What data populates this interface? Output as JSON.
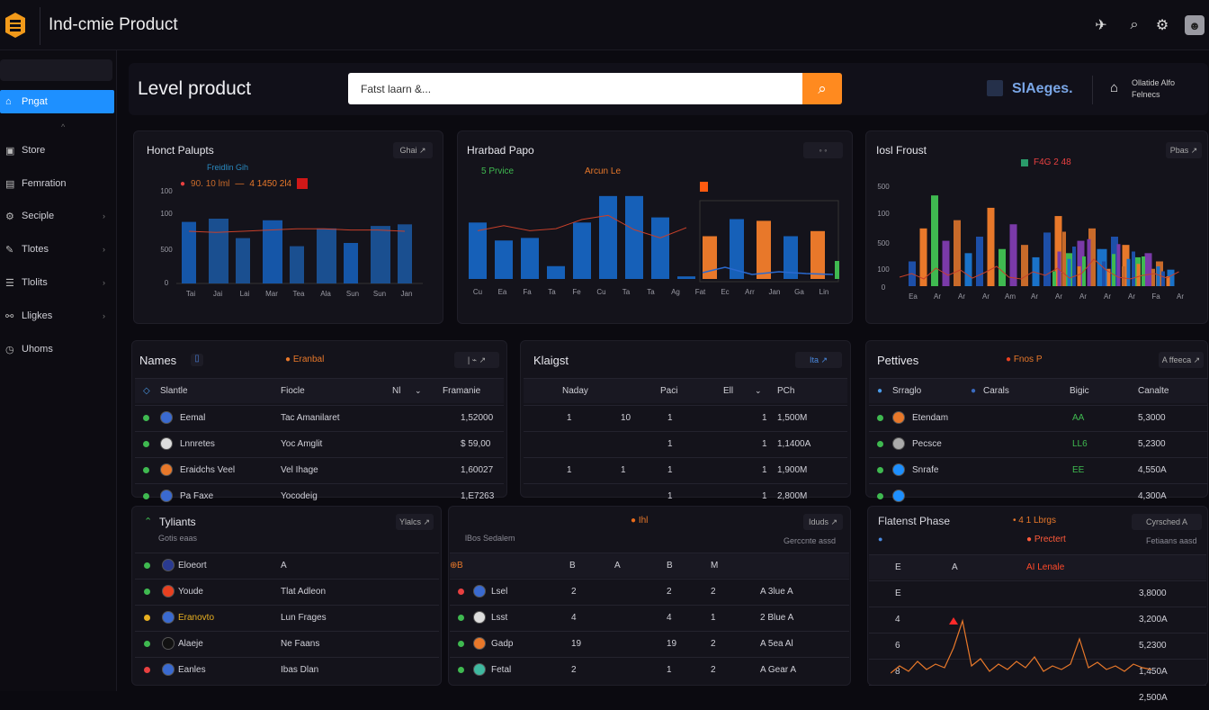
{
  "app": {
    "title": "Ind-cmie Product"
  },
  "header": {
    "page_title": "Level product",
    "search_value": "Fatst laarn &...",
    "brand": "SlAeges.",
    "user_line1": "Ollatide Alfo",
    "user_line2": "Felnecs"
  },
  "sidebar": {
    "items": [
      {
        "label": "Pngat",
        "icon": "home-icon",
        "active": true
      },
      {
        "label": "Store",
        "icon": "store-icon"
      },
      {
        "label": "Femration",
        "icon": "document-icon"
      },
      {
        "label": "Seciple",
        "icon": "gear-icon",
        "chevron": true
      },
      {
        "label": "Tlotes",
        "icon": "pencil-icon",
        "chevron": true
      },
      {
        "label": "Tlolits",
        "icon": "list-icon",
        "chevron": true
      },
      {
        "label": "Lligkes",
        "icon": "link-icon",
        "chevron": true
      },
      {
        "label": "Uhoms",
        "icon": "clock-icon"
      }
    ]
  },
  "charts": {
    "left": {
      "title": "Honct Palupts",
      "btn": "Ghai ↗",
      "legend1": "Freidlin Gih",
      "legend2": "90. 10 lml",
      "legend3": "4 1450 2l4",
      "yticks": [
        "100",
        "100",
        "500",
        "0"
      ],
      "xticks": [
        "Tai",
        "Jai",
        "Lai",
        "Mar",
        "Tea",
        "Ala",
        "Sun",
        "Sun",
        "Jan"
      ]
    },
    "mid": {
      "title": "Hrarbad Papo",
      "btn": "◦ ◦",
      "legend1": "5  Prvice",
      "legend2": "Arcun  Le",
      "xticks": [
        "Cu",
        "Ea",
        "Fa",
        "Ta",
        "Fe",
        "Cu",
        "Ta",
        "Ta",
        "Ag",
        "Fat",
        "Ec",
        "Arr",
        "Jan",
        "Ga",
        "Lin"
      ]
    },
    "right": {
      "title": "Iosl Froust",
      "btn": "Pbas ↗",
      "legend": "F4G 2 48",
      "yticks": [
        "500",
        "100",
        "500",
        "100",
        "0"
      ],
      "xticks": [
        "Ea",
        "Ar",
        "Ar",
        "Ar",
        "Am",
        "Ar",
        "Ar",
        "Ar",
        "Ar",
        "Ar",
        "Fa",
        "Ar"
      ]
    }
  },
  "chart_data": [
    {
      "type": "bar",
      "title": "Honct Palupts",
      "categories": [
        "Tai",
        "Jai",
        "Lai",
        "Mar",
        "Tea",
        "Ala",
        "Sun",
        "Sun",
        "Jan"
      ],
      "values": [
        76,
        80,
        56,
        78,
        46,
        68,
        50,
        71,
        73
      ],
      "line": [
        43,
        42,
        43,
        44,
        45,
        45,
        44,
        44,
        43
      ]
    },
    {
      "type": "bar",
      "title": "Hrarbad Papo",
      "categories": [
        "Cu",
        "Ea",
        "Fa",
        "Ta",
        "Fe",
        "Cu",
        "Ta",
        "Ta",
        "Ag"
      ],
      "values": [
        66,
        45,
        48,
        15,
        66,
        97,
        97,
        72,
        3
      ],
      "line": [
        47,
        52,
        47,
        49,
        58,
        62,
        48,
        40,
        50
      ]
    },
    {
      "type": "bar",
      "title": "Iosl Froust",
      "values": [
        30,
        70,
        110,
        55,
        80,
        40,
        60,
        95,
        45,
        75,
        50,
        35,
        65,
        85,
        40,
        55,
        70,
        45,
        60,
        50,
        35,
        40,
        30,
        20
      ],
      "line": [
        10,
        14,
        8,
        20,
        12,
        18,
        9,
        15,
        22,
        10,
        8,
        16,
        12,
        20,
        9,
        14,
        30,
        18,
        10,
        8,
        12,
        14,
        9,
        16
      ]
    }
  ],
  "tables": {
    "names": {
      "title": "Names",
      "chip": "Eranbal",
      "btn": "| ⌁ ↗",
      "headers": [
        "Slantle",
        "Fiocle",
        "Nl",
        "Framanie"
      ],
      "rows": [
        {
          "name": "Eemal",
          "desc": "Tac Amanilaret",
          "val": "1,52000"
        },
        {
          "name": "Lnnretes",
          "desc": "Yoc Amglit",
          "val": "$ 59,00"
        },
        {
          "name": "Eraidchs Veel",
          "desc": "Vel Ihage",
          "val": "1,60027"
        },
        {
          "name": "Pa Faxe",
          "desc": "Yocodeig",
          "val": "1,E7263"
        }
      ]
    },
    "mid": {
      "title": "Klaigst",
      "btn": "Ita ↗",
      "headers": [
        "Naday",
        "Paci",
        "Ell",
        "PCh"
      ],
      "rows": [
        {
          "a": "1",
          "b": "10",
          "c": "1",
          "d": "1,500M"
        },
        {
          "a": "",
          "b": "",
          "c": "1",
          "d": "1,1400A"
        },
        {
          "a": "1",
          "b": "1",
          "c": "1",
          "d": "1,900M"
        },
        {
          "a": "",
          "b": "",
          "c": "1",
          "d": "2,800M"
        }
      ]
    },
    "right": {
      "title": "Pettives",
      "chip": "Fnos P",
      "btn": "A ffeeca ↗",
      "headers": [
        "Srraglo",
        "Carals",
        "Bigic",
        "Canalte"
      ],
      "rows": [
        {
          "name": "Etendam",
          "tag": "AA",
          "val": "5,3000"
        },
        {
          "name": "Pecsce",
          "tag": "LL6",
          "val": "5,2300"
        },
        {
          "name": "Snrafe",
          "tag": "EE",
          "val": "4,550A"
        },
        {
          "name": "",
          "tag": "",
          "val": "4,300A"
        }
      ]
    },
    "bl": {
      "title": "Tyliants",
      "subtitle": "Gotis eaas",
      "btn": "Ylalcs ↗",
      "rows": [
        {
          "name": "Eloeort",
          "desc": "A"
        },
        {
          "name": "Youde",
          "desc": "Tlat Adleon"
        },
        {
          "name": "Eranovto",
          "desc": "Lun Frages"
        },
        {
          "name": "Alaeje",
          "desc": "Ne Faans"
        },
        {
          "name": "Eanles",
          "desc": "Ibas Dlan"
        }
      ]
    },
    "bm": {
      "title": "Ihl",
      "subtitle": "lBos Sedalem",
      "btn": "Iduds ↗",
      "btn2": "Gerccnte assd",
      "rows": [
        {
          "name": "Lsel",
          "a": "2",
          "b": "2",
          "c": "2",
          "d": "A 3lue A"
        },
        {
          "name": "Lsst",
          "a": "4",
          "b": "4",
          "c": "1",
          "d": "2 Blue A"
        },
        {
          "name": "Gadp",
          "a": "19",
          "b": "19",
          "c": "2",
          "d": "A 5ea Al"
        },
        {
          "name": "Fetal",
          "a": "2",
          "b": "1",
          "c": "2",
          "d": "A Gear A"
        }
      ]
    },
    "br": {
      "title": "Flatenst Phase",
      "sub": "4 1 Lbrgs",
      "chip": "Prectert",
      "btn": "Cyrsched A",
      "btn2": "Fetiaans aasd",
      "tag": "AI Lenale",
      "headers": [
        "E",
        "A"
      ],
      "rows": [
        {
          "k": "E",
          "v": "3,8000"
        },
        {
          "k": "4",
          "v": "3,200A"
        },
        {
          "k": "6",
          "v": "5,2300"
        },
        {
          "k": "8",
          "v": "1,450A"
        },
        {
          "k": "",
          "v": "2,500A"
        }
      ]
    }
  },
  "colors": {
    "accent": "#1e90ff",
    "search_btn": "#ff8a1f",
    "bar_blue": "#1a5fb4",
    "orange": "#e8782a",
    "green": "#3fb950"
  }
}
